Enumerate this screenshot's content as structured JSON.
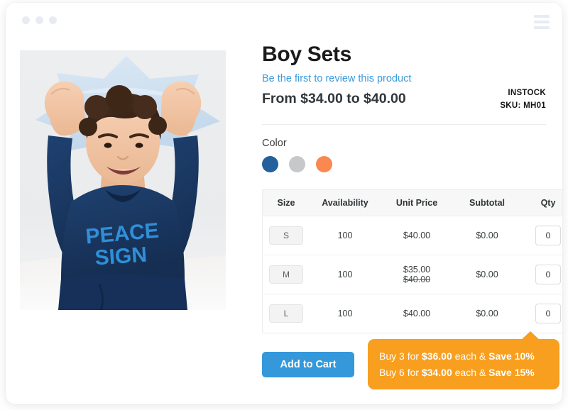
{
  "window": {
    "dots": [
      "dot-1",
      "dot-2",
      "dot-3"
    ],
    "menu_icon": "hamburger-menu-icon"
  },
  "product": {
    "title": "Boy Sets",
    "review_link": "Be the first to review this product",
    "price_range": "From $34.00 to $40.00",
    "stock_status": "INSTOCK",
    "sku": "SKU: MH01",
    "image_alt": "Boy wearing navy long-sleeve PEACE SIGN top holding a light blue star pillow"
  },
  "color_option": {
    "label": "Color",
    "swatches": [
      {
        "name": "blue",
        "hex": "#23609c"
      },
      {
        "name": "gray",
        "hex": "#c6c8ca"
      },
      {
        "name": "orange",
        "hex": "#f98851"
      }
    ]
  },
  "table": {
    "headers": [
      "Size",
      "Availability",
      "Unit Price",
      "Subtotal",
      "Qty"
    ],
    "rows": [
      {
        "size": "S",
        "availability": "100",
        "unit_price": "$40.00",
        "old_price": "",
        "subtotal": "$0.00",
        "qty": "0"
      },
      {
        "size": "M",
        "availability": "100",
        "unit_price": "$35.00",
        "old_price": "$40.00",
        "subtotal": "$0.00",
        "qty": "0"
      },
      {
        "size": "L",
        "availability": "100",
        "unit_price": "$40.00",
        "old_price": "",
        "subtotal": "$0.00",
        "qty": "0"
      }
    ]
  },
  "actions": {
    "add_to_cart": "Add to Cart"
  },
  "tier_tooltip": {
    "background_hex": "#f89f20",
    "lines": [
      {
        "prefix": "Buy 3 for ",
        "price": "$36.00",
        "middle": " each & ",
        "save": "Save 10%"
      },
      {
        "prefix": "Buy 6 for ",
        "price": "$34.00",
        "middle": " each & ",
        "save": "Save 15%"
      }
    ]
  }
}
